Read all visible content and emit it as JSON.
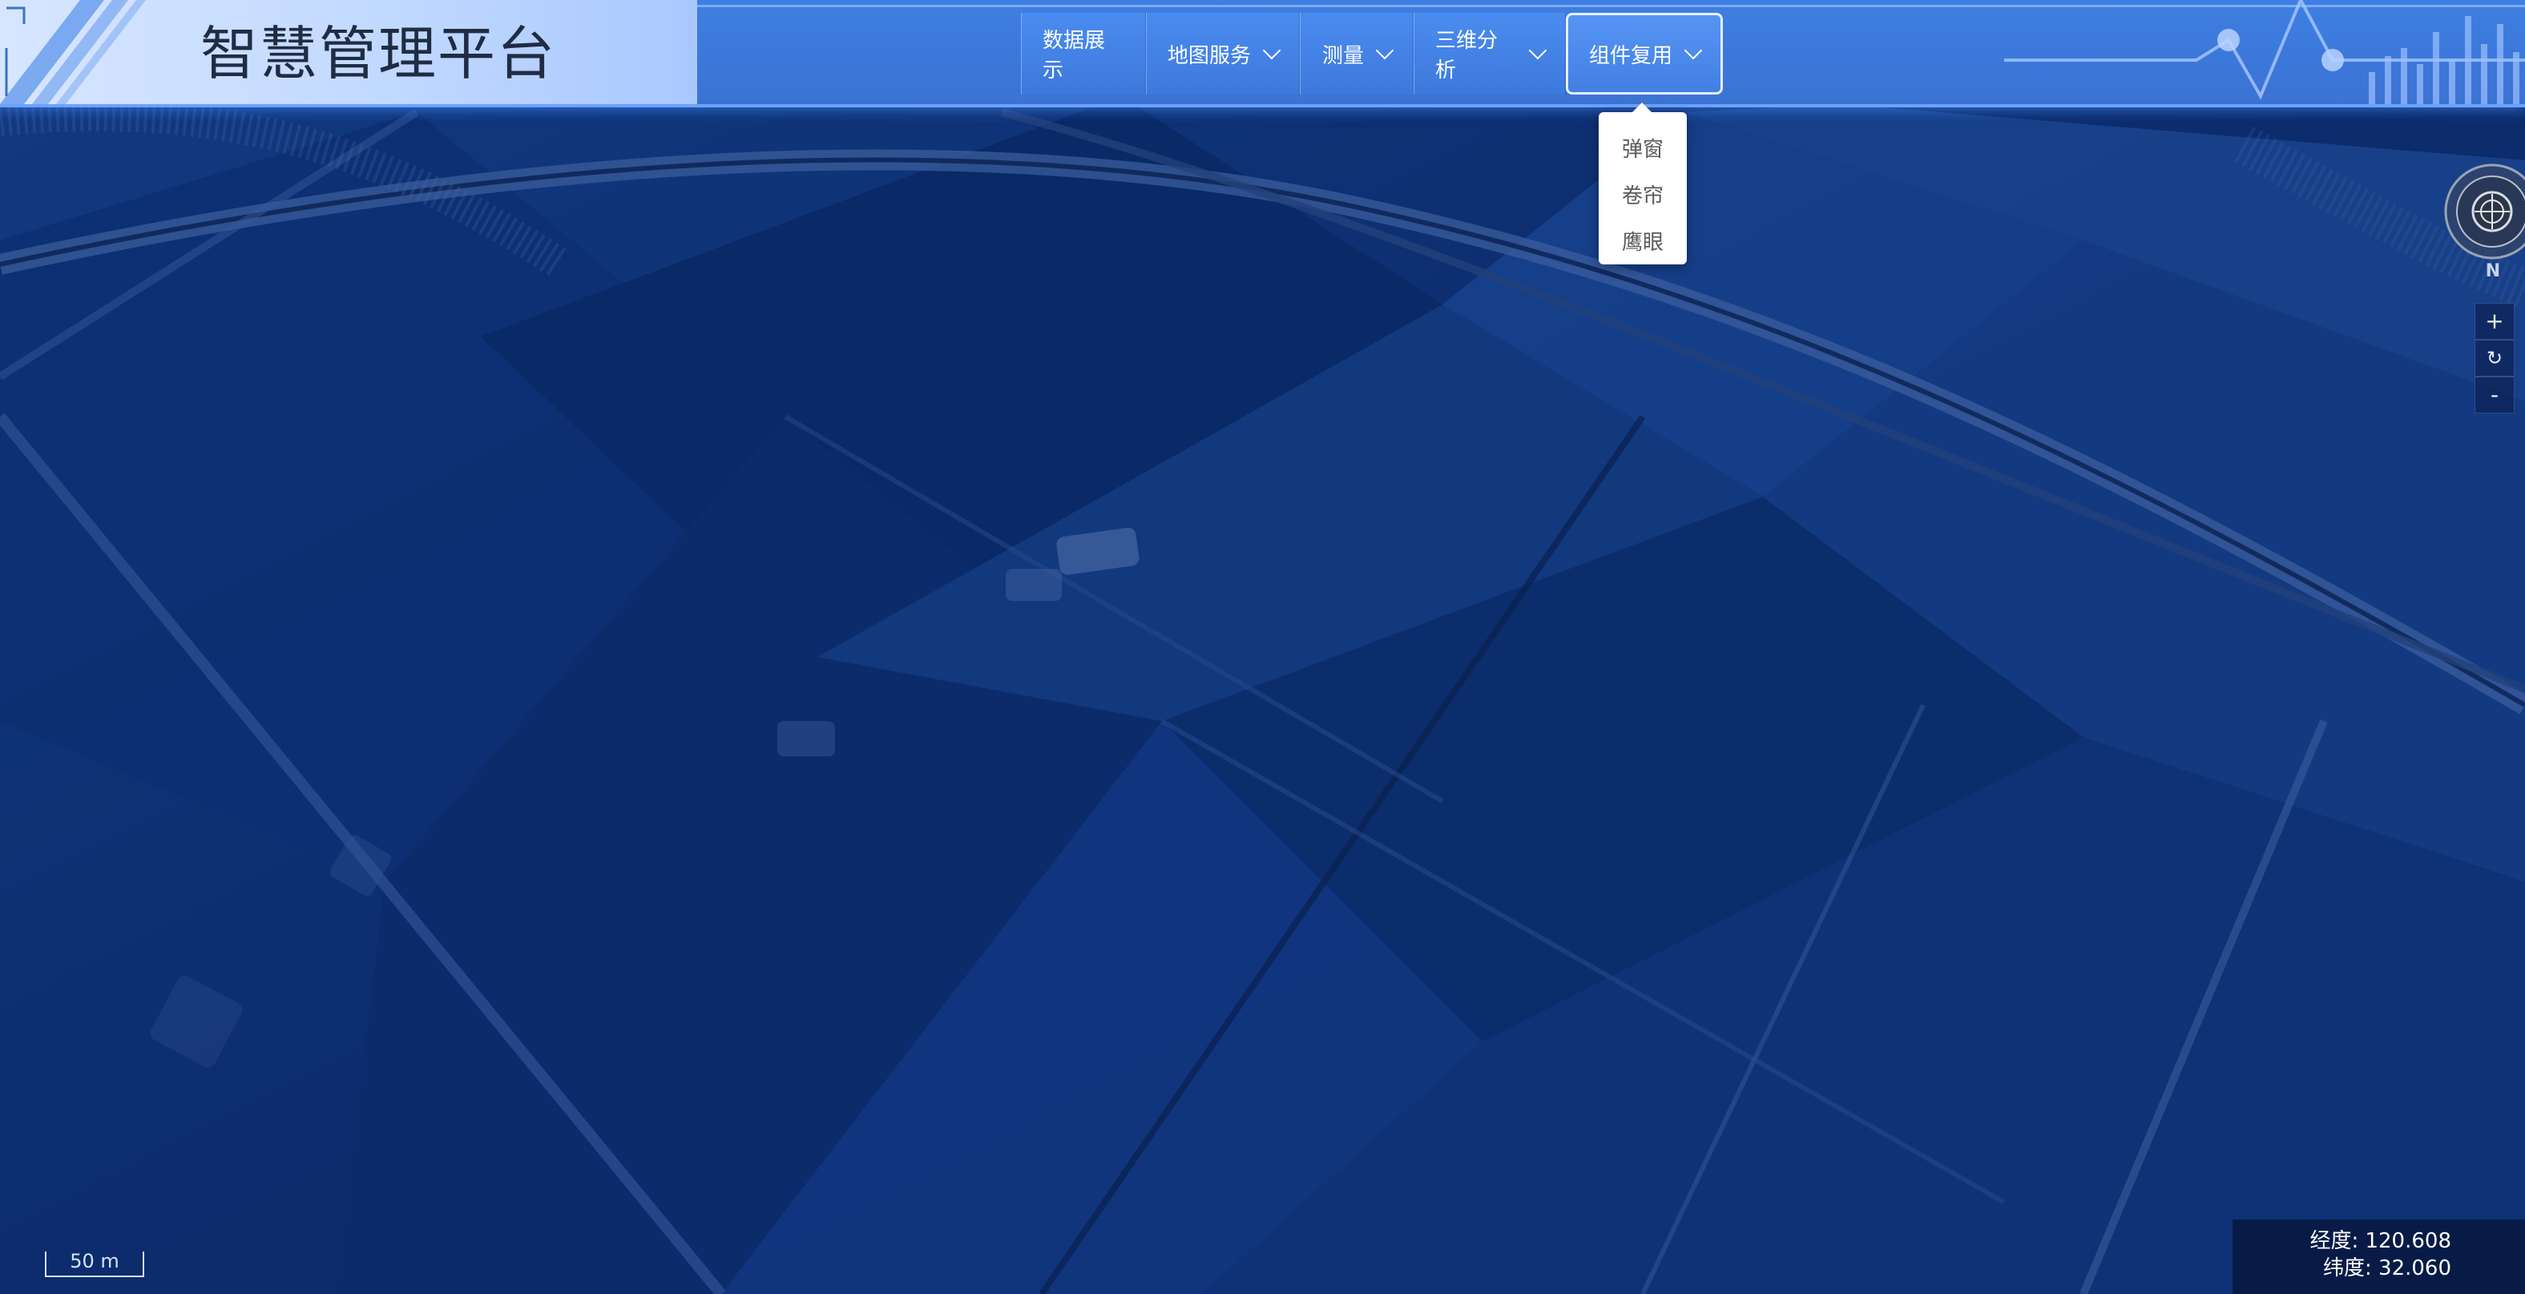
{
  "app": {
    "title": "智慧管理平台"
  },
  "nav": {
    "items": [
      {
        "label": "数据展示",
        "has_dropdown": false
      },
      {
        "label": "地图服务",
        "has_dropdown": true
      },
      {
        "label": "测量",
        "has_dropdown": true
      },
      {
        "label": "三维分析",
        "has_dropdown": true
      },
      {
        "label": "组件复用",
        "has_dropdown": true,
        "active": true
      }
    ]
  },
  "dropdown": {
    "items": [
      {
        "label": "弹窗"
      },
      {
        "label": "卷帘"
      },
      {
        "label": "鹰眼"
      }
    ]
  },
  "compass": {
    "north_label": "N",
    "icon": "compass-icon"
  },
  "zoom": {
    "zoom_in": "+",
    "reset": "↻",
    "zoom_out": "-"
  },
  "scale": {
    "label": "50 m"
  },
  "coords": {
    "lon_text": "经度: 120.608",
    "lat_text": "纬度: 32.060"
  },
  "colors": {
    "header": "#3d79db",
    "title_panel": "#c2d9ff",
    "map_tint": "#0b2a66",
    "accent": "#6aa2ff"
  }
}
